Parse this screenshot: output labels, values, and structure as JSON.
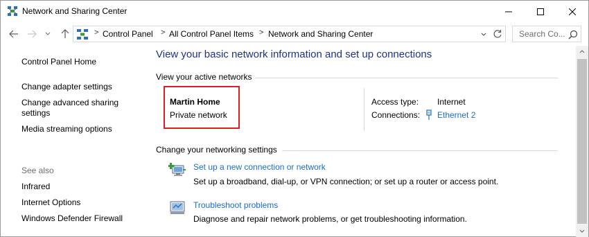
{
  "window": {
    "title": "Network and Sharing Center"
  },
  "address": {
    "crumbs": [
      "Control Panel",
      "All Control Panel Items",
      "Network and Sharing Center"
    ],
    "separator": ">"
  },
  "search": {
    "placeholder": "Search Co..."
  },
  "leftnav": {
    "items": [
      "Control Panel Home",
      "Change adapter settings",
      "Change advanced sharing settings",
      "Media streaming options"
    ],
    "see_also_heading": "See also",
    "see_also": [
      "Infrared",
      "Internet Options",
      "Windows Defender Firewall"
    ]
  },
  "main": {
    "title": "View your basic network information and set up connections",
    "active_networks_heading": "View your active networks",
    "network": {
      "name": "Martin Home",
      "type": "Private network",
      "access_type_label": "Access type:",
      "access_type_value": "Internet",
      "connections_label": "Connections:",
      "connections_value": "Ethernet 2"
    },
    "change_settings_heading": "Change your networking settings",
    "tasks": [
      {
        "icon": "new-connection-icon",
        "link": "Set up a new connection or network",
        "desc": "Set up a broadband, dial-up, or VPN connection; or set up a router or access point."
      },
      {
        "icon": "troubleshoot-icon",
        "link": "Troubleshoot problems",
        "desc": "Diagnose and repair network problems, or get troubleshooting information."
      }
    ]
  },
  "colors": {
    "title_blue": "#1e3287",
    "link_blue": "#1a6cc7",
    "highlight_red": "#d61f26"
  }
}
